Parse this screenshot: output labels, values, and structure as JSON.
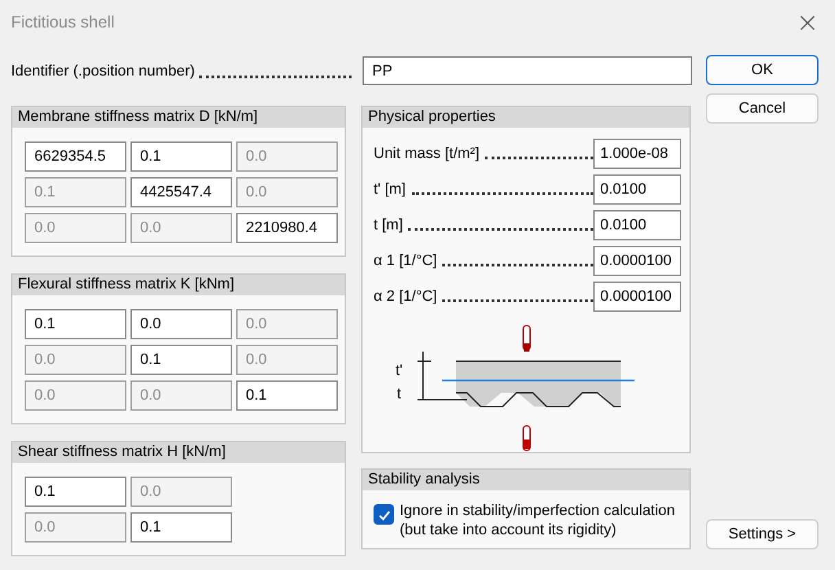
{
  "window": {
    "title": "Fictitious shell",
    "close": "×"
  },
  "identifier": {
    "label": "Identifier (.position number)",
    "value": "PP"
  },
  "buttons": {
    "ok": "OK",
    "cancel": "Cancel",
    "settings": "Settings >"
  },
  "matrices": [
    {
      "title": "Membrane stiffness matrix D [kN/m]",
      "rows": [
        [
          {
            "value": "6629354.5",
            "disabled": false
          },
          {
            "value": "0.1",
            "disabled": false
          },
          {
            "value": "0.0",
            "disabled": true
          }
        ],
        [
          {
            "value": "0.1",
            "disabled": true
          },
          {
            "value": "4425547.4",
            "disabled": false
          },
          {
            "value": "0.0",
            "disabled": true
          }
        ],
        [
          {
            "value": "0.0",
            "disabled": true
          },
          {
            "value": "0.0",
            "disabled": true
          },
          {
            "value": "2210980.4",
            "disabled": false
          }
        ]
      ]
    },
    {
      "title": "Flexural stiffness matrix K [kNm]",
      "rows": [
        [
          {
            "value": "0.1",
            "disabled": false
          },
          {
            "value": "0.0",
            "disabled": false
          },
          {
            "value": "0.0",
            "disabled": true
          }
        ],
        [
          {
            "value": "0.0",
            "disabled": true
          },
          {
            "value": "0.1",
            "disabled": false
          },
          {
            "value": "0.0",
            "disabled": true
          }
        ],
        [
          {
            "value": "0.0",
            "disabled": true
          },
          {
            "value": "0.0",
            "disabled": true
          },
          {
            "value": "0.1",
            "disabled": false
          }
        ]
      ]
    },
    {
      "title": "Shear stiffness matrix H [kN/m]",
      "rows": [
        [
          {
            "value": "0.1",
            "disabled": false
          },
          {
            "value": "0.0",
            "disabled": true
          }
        ],
        [
          {
            "value": "0.0",
            "disabled": true
          },
          {
            "value": "0.1",
            "disabled": false
          }
        ]
      ]
    }
  ],
  "physical_properties": {
    "title": "Physical properties",
    "fields": [
      {
        "label": "Unit mass [t/m²]",
        "value": "1.000e-08"
      },
      {
        "label": "t' [m]",
        "value": "0.0100"
      },
      {
        "label": "t [m]",
        "value": "0.0100"
      },
      {
        "label": "α 1 [1/°C]",
        "value": "0.0000100"
      },
      {
        "label": "α 2 [1/°C]",
        "value": "0.0000100"
      }
    ],
    "diagram_labels": [
      "t'",
      "t"
    ]
  },
  "stability": {
    "title": "Stability analysis",
    "checkbox": {
      "label": "Ignore in stability/imperfection calculation (but take into account its rigidity)",
      "checked": true
    }
  }
}
